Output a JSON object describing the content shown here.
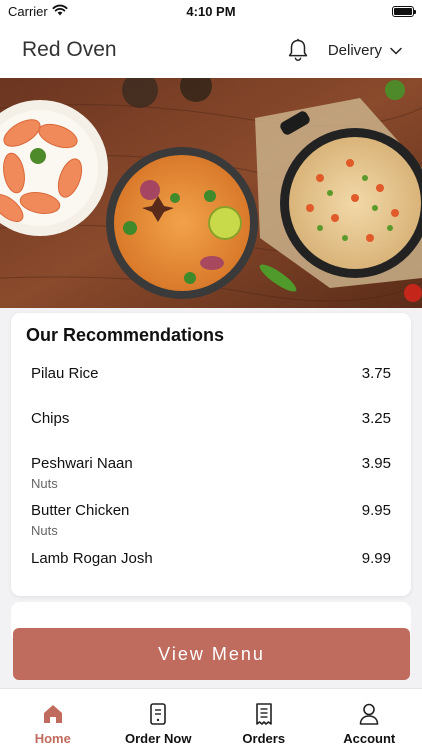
{
  "status_bar": {
    "carrier": "Carrier",
    "time": "4:10 PM",
    "battery_level": 1.0
  },
  "header": {
    "title": "Red Oven",
    "notification_icon": "bell-icon",
    "delivery_label": "Delivery",
    "dropdown_icon": "chevron-down-icon"
  },
  "hero": {
    "description_icon": "food-banner"
  },
  "recommendations": {
    "title": "Our Recommendations",
    "items": [
      {
        "name": "Pilau Rice",
        "price": "3.75",
        "note": ""
      },
      {
        "name": "Chips",
        "price": "3.25",
        "note": ""
      },
      {
        "name": "Peshwari Naan",
        "price": "3.95",
        "note": "Nuts"
      },
      {
        "name": "Butter Chicken",
        "price": "9.95",
        "note": "Nuts"
      },
      {
        "name": "Lamb Rogan Josh",
        "price": "9.99",
        "note": ""
      }
    ]
  },
  "view_menu_label": "View Menu",
  "tabs": [
    {
      "label": "Home",
      "icon": "home-icon",
      "active": true
    },
    {
      "label": "Order Now",
      "icon": "order-now-icon",
      "active": false
    },
    {
      "label": "Orders",
      "icon": "receipt-icon",
      "active": false
    },
    {
      "label": "Account",
      "icon": "person-icon",
      "active": false
    }
  ],
  "colors": {
    "accent": "#bf6b5d",
    "background": "#f2f2f4"
  }
}
